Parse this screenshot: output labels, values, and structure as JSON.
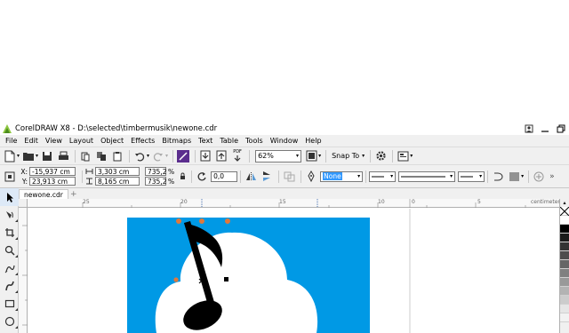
{
  "window": {
    "title": "CorelDRAW X8 - D:\\selected\\timbermusik\\newone.cdr",
    "controls": [
      "user-icon",
      "minimize-icon",
      "maximize-icon"
    ]
  },
  "menu": {
    "items": [
      {
        "label": "File"
      },
      {
        "label": "Edit"
      },
      {
        "label": "View"
      },
      {
        "label": "Layout"
      },
      {
        "label": "Object"
      },
      {
        "label": "Effects"
      },
      {
        "label": "Bitmaps"
      },
      {
        "label": "Text"
      },
      {
        "label": "Table"
      },
      {
        "label": "Tools"
      },
      {
        "label": "Window"
      },
      {
        "label": "Help"
      }
    ]
  },
  "toolbar": {
    "zoom_value": "62%",
    "snap_label": "Snap To",
    "pdf_label": "PDF"
  },
  "properties": {
    "x_label": "X:",
    "y_label": "Y:",
    "x_value": "-15,937 cm",
    "y_value": "23,913 cm",
    "width_value": "3,303 cm",
    "height_value": "8,165 cm",
    "scale_x": "735,2",
    "scale_y": "735,2",
    "percent": "%",
    "rotation": "0,0",
    "outline_value": "None"
  },
  "document": {
    "tab_label": "newone.cdr",
    "ruler_unit": "centimeters",
    "ruler_labels": [
      "25",
      "20",
      "15",
      "10",
      "5",
      "0",
      "5"
    ]
  },
  "colors": {
    "accent_blue": "#0099e5",
    "menu_bg": "#f0f0f0",
    "handle_orange": "#e0783c"
  },
  "palette": {
    "swatches": [
      "#ffffff",
      "#000000",
      "#1a1a1a",
      "#333333",
      "#4d4d4d",
      "#666666",
      "#808080",
      "#999999",
      "#b3b3b3",
      "#cccccc",
      "#e6e6e6",
      "#f2f2f2"
    ]
  }
}
